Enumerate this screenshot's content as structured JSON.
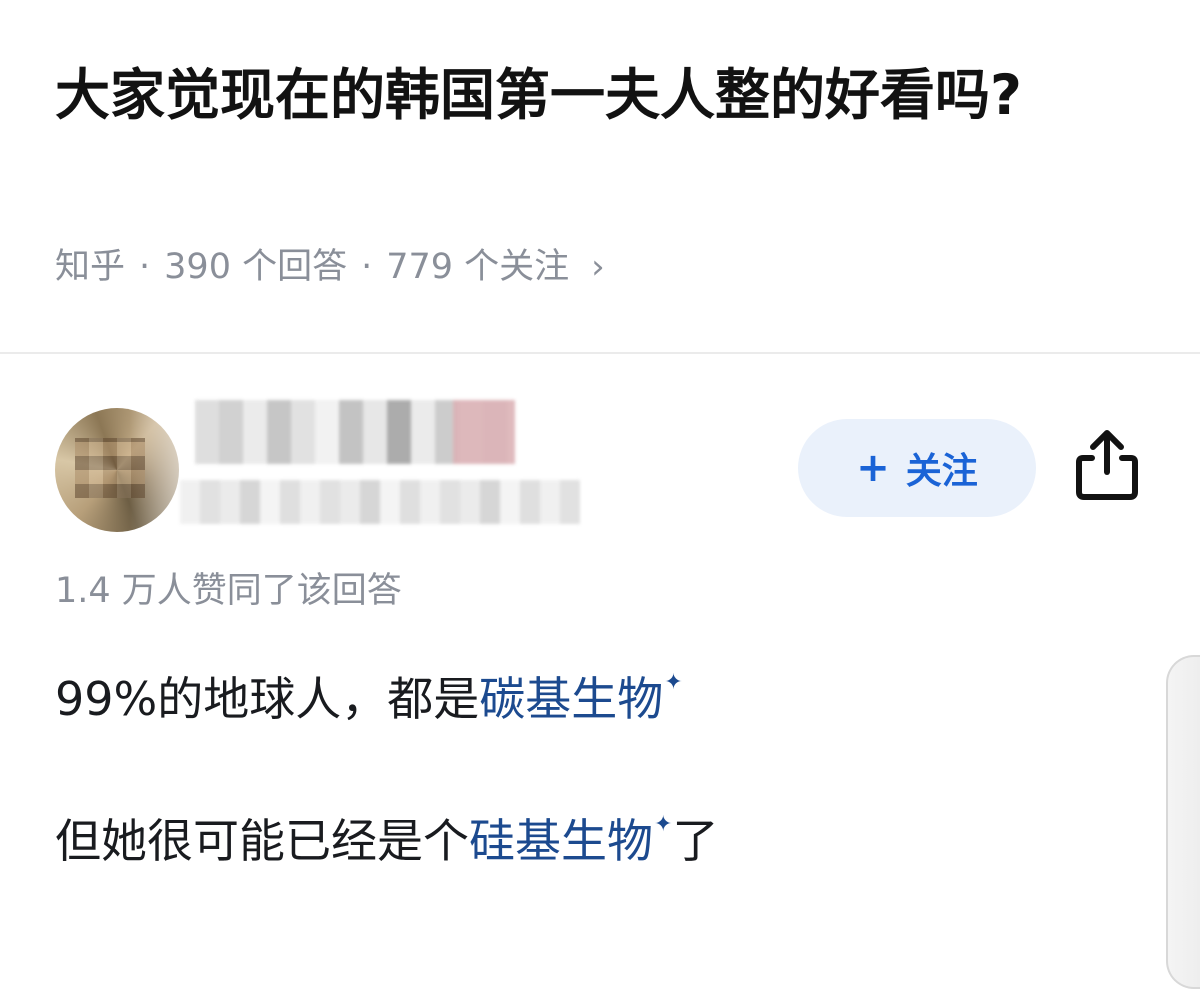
{
  "question": {
    "title": "大家觉现在的韩国第一夫人整的好看吗?",
    "source": "知乎",
    "separator": "·",
    "answers_count": "390 个回答",
    "followers_count": "779 个关注",
    "chevron": "›"
  },
  "answer": {
    "follow_plus": "+",
    "follow_label": "关注",
    "votes_text": "1.4 万人赞同了该回答",
    "line1": {
      "prefix": "99%的地球人，都是",
      "link": "碳基生物",
      "sparkle": "✦"
    },
    "line2": {
      "prefix": "但她很可能已经是个",
      "link": "硅基生物",
      "sparkle": "✦",
      "suffix": "了"
    }
  },
  "icons": {
    "share": "share-icon",
    "sparkle": "sparkle-icon"
  },
  "colors": {
    "link": "#1c4a8f",
    "follow_text": "#1a63d6",
    "follow_bg": "#eaf1fb",
    "meta_gray": "#8a8f99"
  }
}
